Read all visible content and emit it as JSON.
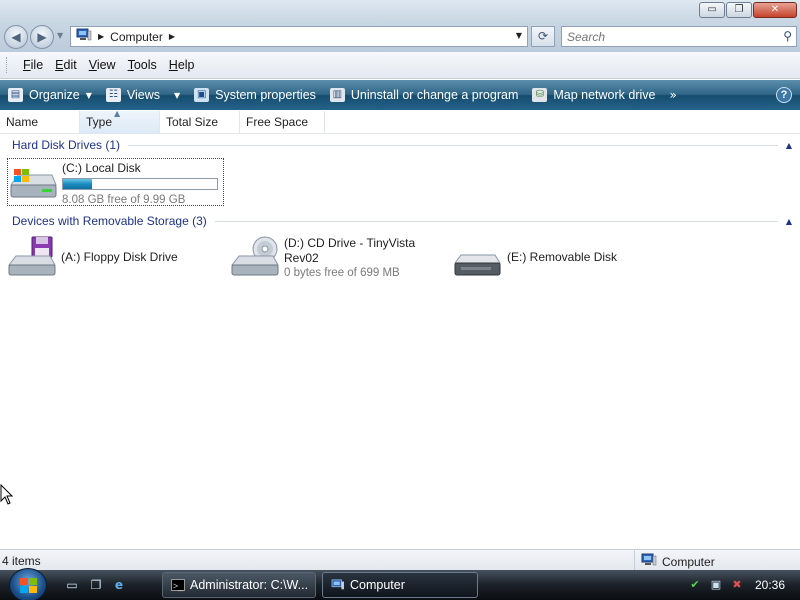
{
  "window": {
    "minimize_glyph": "▭",
    "maximize_glyph": "❐",
    "close_glyph": "✕"
  },
  "address": {
    "crumb": "Computer",
    "back_glyph": "◀",
    "forward_glyph": "▶",
    "refresh_glyph": "⟳"
  },
  "search": {
    "placeholder": "Search"
  },
  "menu": {
    "file": {
      "first": "F",
      "rest": "ile"
    },
    "edit": {
      "first": "E",
      "rest": "dit"
    },
    "view": {
      "first": "V",
      "rest": "iew"
    },
    "tools": {
      "first": "T",
      "rest": "ools"
    },
    "help": {
      "first": "H",
      "rest": "elp"
    }
  },
  "commands": {
    "organize": "Organize",
    "views": "Views",
    "system_properties": "System properties",
    "uninstall": "Uninstall or change a program",
    "map_network_drive": "Map network drive",
    "more": "»",
    "help": "?"
  },
  "columns": {
    "name": "Name",
    "type": "Type",
    "total_size": "Total Size",
    "free_space": "Free Space"
  },
  "groups": {
    "hard_disks": {
      "title": "Hard Disk Drives (1)",
      "items": [
        {
          "name": "(C:) Local Disk",
          "free": "8.08 GB free of 9.99 GB",
          "used_fraction": 0.19
        }
      ]
    },
    "removable": {
      "title": "Devices with Removable Storage (3)",
      "items": [
        {
          "name": "(A:) Floppy Disk Drive"
        },
        {
          "name": "(D:) CD Drive - TinyVista",
          "name2": "Rev02",
          "free": "0 bytes free of 699 MB"
        },
        {
          "name": "(E:) Removable Disk"
        }
      ]
    }
  },
  "status": {
    "count": "4 items",
    "location": "Computer"
  },
  "taskbar": {
    "buttons": [
      {
        "label": "Administrator: C:\\W..."
      },
      {
        "label": "Computer"
      }
    ],
    "clock": "20:36"
  },
  "colors": {
    "group_title": "#1e3287",
    "command_bar": "#2f6586",
    "capacity_fill": "#1b8cc0"
  }
}
